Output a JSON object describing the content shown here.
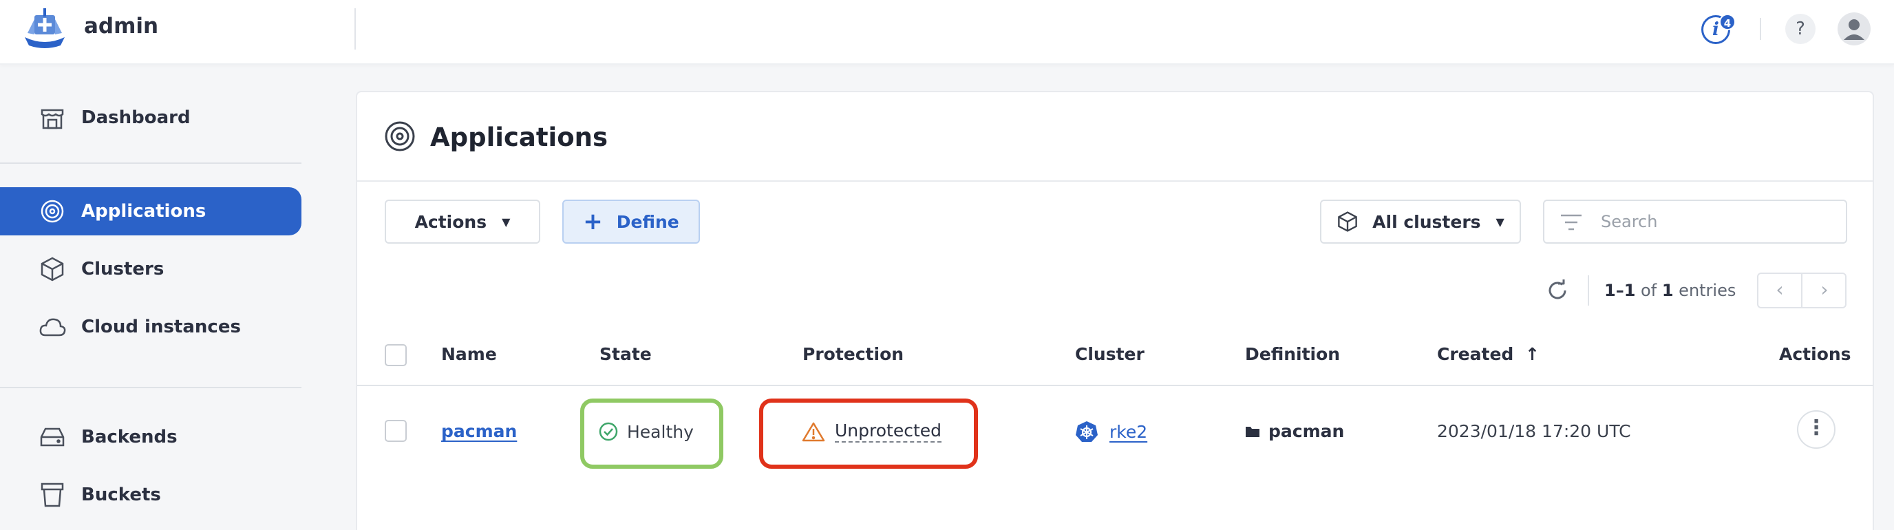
{
  "header": {
    "brand_name": "admin",
    "notification_count": "4",
    "info_label": "i",
    "help_label": "?"
  },
  "sidebar": {
    "items": [
      {
        "label": "Dashboard",
        "icon": "dashboard-icon"
      },
      {
        "label": "Applications",
        "icon": "applications-icon",
        "active": true
      },
      {
        "label": "Clusters",
        "icon": "cluster-icon"
      },
      {
        "label": "Cloud instances",
        "icon": "cloud-icon"
      },
      {
        "label": "Backends",
        "icon": "drive-icon"
      },
      {
        "label": "Buckets",
        "icon": "bucket-icon"
      }
    ]
  },
  "page": {
    "title": "Applications",
    "actions_label": "Actions",
    "define_label": "Define",
    "cluster_filter": "All clusters",
    "search_placeholder": "Search",
    "pagination": {
      "range": "1–1",
      "of": "of",
      "total": "1",
      "suffix": "entries"
    }
  },
  "table": {
    "columns": [
      "Name",
      "State",
      "Protection",
      "Cluster",
      "Definition",
      "Created",
      "Actions"
    ],
    "sort_indicator": "↑",
    "rows": [
      {
        "name": "pacman",
        "state": "Healthy",
        "protection": "Unprotected",
        "cluster": "rke2",
        "definition": "pacman",
        "created": "2023/01/18 17:20 UTC"
      }
    ]
  },
  "colors": {
    "primary": "#2b62c8",
    "healthy_highlight": "#8fc963",
    "unprotected_highlight": "#e0321a",
    "warning": "#e07a2e",
    "healthy_icon": "#3fa66a"
  }
}
